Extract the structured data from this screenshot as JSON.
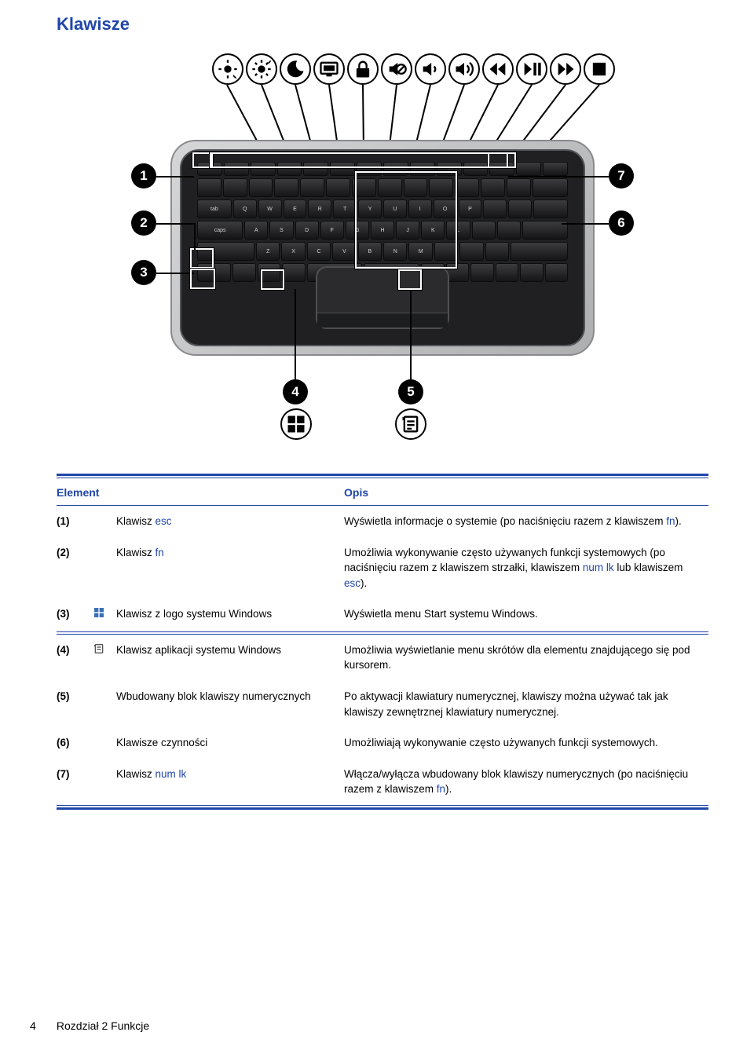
{
  "title": "Klawisze",
  "illustration": {
    "top_icons": [
      "brightness-down-icon",
      "brightness-up-icon",
      "sleep-icon",
      "switch-display-icon",
      "lock-icon",
      "mute-icon",
      "volume-down-icon",
      "volume-up-icon",
      "media-prev-icon",
      "media-play-pause-icon",
      "media-next-icon",
      "media-stop-icon"
    ],
    "callouts": [
      {
        "n": "1",
        "side": "left"
      },
      {
        "n": "2",
        "side": "left"
      },
      {
        "n": "3",
        "side": "left"
      },
      {
        "n": "4",
        "side": "bottom"
      },
      {
        "n": "5",
        "side": "bottom"
      },
      {
        "n": "6",
        "side": "right"
      },
      {
        "n": "7",
        "side": "right"
      }
    ]
  },
  "table": {
    "headers": {
      "element": "Element",
      "opis": "Opis"
    },
    "rows": [
      {
        "num": "(1)",
        "icon": null,
        "name": [
          {
            "t": "Klawisz "
          },
          {
            "t": "esc",
            "kw": true
          }
        ],
        "desc": [
          {
            "t": "Wyświetla informacje o systemie (po naciśnięciu razem z klawiszem "
          },
          {
            "t": "fn",
            "kw": true
          },
          {
            "t": ")."
          }
        ]
      },
      {
        "num": "(2)",
        "icon": null,
        "name": [
          {
            "t": "Klawisz "
          },
          {
            "t": "fn",
            "kw": true
          }
        ],
        "desc": [
          {
            "t": "Umożliwia wykonywanie często używanych funkcji systemowych (po naciśnięciu razem z klawiszem strzałki, klawiszem "
          },
          {
            "t": "num lk",
            "kw": true
          },
          {
            "t": " lub klawiszem "
          },
          {
            "t": "esc",
            "kw": true
          },
          {
            "t": ")."
          }
        ]
      },
      {
        "num": "(3)",
        "icon": "windows-logo-icon",
        "name": [
          {
            "t": "Klawisz z logo systemu Windows"
          }
        ],
        "desc": [
          {
            "t": "Wyświetla menu Start systemu Windows."
          }
        ]
      },
      {
        "separator": true
      },
      {
        "num": "(4)",
        "icon": "windows-app-icon",
        "name": [
          {
            "t": "Klawisz aplikacji systemu Windows"
          }
        ],
        "desc": [
          {
            "t": "Umożliwia wyświetlanie menu skrótów dla elementu znajdującego się pod kursorem."
          }
        ]
      },
      {
        "num": "(5)",
        "icon": null,
        "name": [
          {
            "t": "Wbudowany blok klawiszy numerycznych"
          }
        ],
        "desc": [
          {
            "t": "Po aktywacji klawiatury numerycznej, klawiszy można używać tak jak klawiszy zewnętrznej klawiatury numerycznej."
          }
        ]
      },
      {
        "num": "(6)",
        "icon": null,
        "name": [
          {
            "t": "Klawisze czynności"
          }
        ],
        "desc": [
          {
            "t": "Umożliwiają wykonywanie często używanych funkcji systemowych."
          }
        ]
      },
      {
        "num": "(7)",
        "icon": null,
        "name": [
          {
            "t": "Klawisz "
          },
          {
            "t": "num lk",
            "kw": true
          }
        ],
        "desc": [
          {
            "t": "Włącza/wyłącza wbudowany blok klawiszy numerycznych (po naciśnięciu razem z klawiszem "
          },
          {
            "t": "fn",
            "kw": true
          },
          {
            "t": ")."
          }
        ]
      }
    ]
  },
  "footer": {
    "page_number": "4",
    "chapter": "Rozdział 2   Funkcje"
  }
}
